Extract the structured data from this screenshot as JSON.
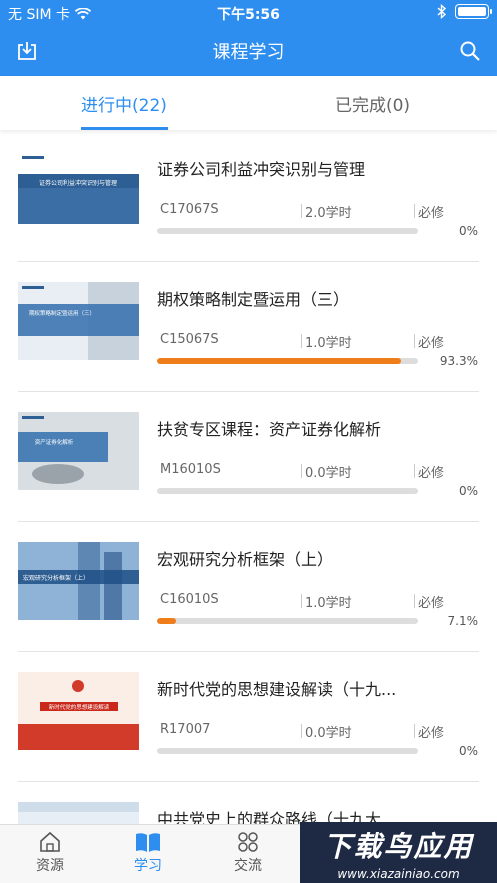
{
  "status": {
    "carrier": "无 SIM 卡",
    "time": "下午5:56"
  },
  "nav": {
    "title": "课程学习"
  },
  "tabs": [
    {
      "label": "进行中(22)",
      "active": true
    },
    {
      "label": "已完成(0)",
      "active": false
    }
  ],
  "courses": [
    {
      "title": "证券公司利益冲突识别与管理",
      "code": "C17067S",
      "hours": "2.0学时",
      "type": "必修",
      "progress_label": "0%",
      "progress": 0,
      "thumb_text": "证券公司利益冲突识别与管理"
    },
    {
      "title": "期权策略制定暨运用（三）",
      "code": "C15067S",
      "hours": "1.0学时",
      "type": "必修",
      "progress_label": "93.3%",
      "progress": 93.3,
      "thumb_text": "期权策略制定暨运用（三）"
    },
    {
      "title": "扶贫专区课程：资产证券化解析",
      "code": "M16010S",
      "hours": "0.0学时",
      "type": "必修",
      "progress_label": "0%",
      "progress": 0,
      "thumb_text": "资产证券化解析"
    },
    {
      "title": "宏观研究分析框架（上）",
      "code": "C16010S",
      "hours": "1.0学时",
      "type": "必修",
      "progress_label": "7.1%",
      "progress": 7.1,
      "thumb_text": "宏观研究分析框架（上）"
    },
    {
      "title": "新时代党的思想建设解读（十九...",
      "code": "R17007",
      "hours": "0.0学时",
      "type": "必修",
      "progress_label": "0%",
      "progress": 0,
      "thumb_text": "新时代党的思想建设解读"
    },
    {
      "title": "中共党史上的群众路线（十九大...",
      "code": "",
      "hours": "",
      "type": "",
      "progress_label": "",
      "progress": 0,
      "thumb_text": ""
    }
  ],
  "tabbar": [
    {
      "label": "资源",
      "icon": "home-icon",
      "active": false
    },
    {
      "label": "学习",
      "icon": "book-icon",
      "active": true
    },
    {
      "label": "交流",
      "icon": "grid-icon",
      "active": false
    }
  ],
  "watermark": {
    "line1": "下载鸟应用",
    "line2": "www.xiazainiao.com"
  },
  "colors": {
    "accent": "#2d8ef0",
    "progress": "#ef7d1a"
  }
}
